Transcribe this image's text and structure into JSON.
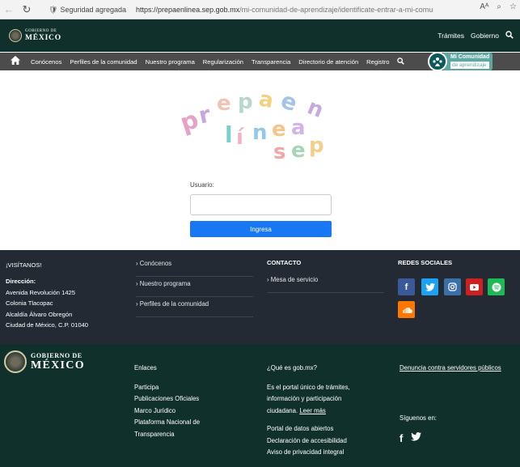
{
  "browser": {
    "security_label": "Seguridad agregada",
    "url_host": "https://prepaenlinea.sep.gob.mx",
    "url_path": "/mi-comunidad-de-aprendizaje/identificate-entrar-a-mi-comunidad/",
    "read_aloud_label": "Aᴬ",
    "zoom_icon": "magnifier-icon",
    "favorites_icon": "star-icon"
  },
  "gov_header": {
    "logo_small": "GOBIERNO DE",
    "logo_big": "MÉXICO",
    "links": [
      "Trámites",
      "Gobierno"
    ]
  },
  "main_nav": {
    "items": [
      "Conócenos",
      "Perfiles de la comunidad",
      "Nuestro programa",
      "Regularización",
      "Transparencia",
      "Directorio de atención",
      "Registro"
    ],
    "badge_line1": "Mi Comunidad",
    "badge_line2": "de aprendizaje"
  },
  "login": {
    "user_label": "Usuario:",
    "user_value": "",
    "submit_label": "Ingresa"
  },
  "footer_top": {
    "visit_title": "¡VISÍTANOS!",
    "address_title": "Dirección:",
    "address_lines": [
      "Avenida Revolución 1425",
      "Colonia Tlacopac",
      "Alcaldía Álvaro Obregón",
      "Ciudad de México, C.P. 01040"
    ],
    "links": [
      "Conócenos",
      "Nuestro programa",
      "Perfiles de la comunidad"
    ],
    "contact_title": "CONTACTO",
    "contact_link": "Mesa de servicio",
    "social_title": "REDES SOCIALES",
    "social": [
      {
        "name": "facebook",
        "glyph": "f",
        "color": "#3b5998"
      },
      {
        "name": "twitter",
        "glyph": "t",
        "color": "#1da1f2"
      },
      {
        "name": "instagram",
        "glyph": "◎",
        "color": "#3a6fa8"
      },
      {
        "name": "youtube",
        "glyph": "▶",
        "color": "#cd201f"
      },
      {
        "name": "spotify",
        "glyph": "≡",
        "color": "#1db954"
      },
      {
        "name": "soundcloud",
        "glyph": "☁",
        "color": "#ff7700"
      }
    ]
  },
  "footer_bottom": {
    "logo_small": "GOBIERNO DE",
    "logo_big": "MÉXICO",
    "links_title": "Enlaces",
    "links": [
      "Participa",
      "Publicaciones Oficiales",
      "Marco Jurídico",
      "Plataforma Nacional de",
      "Transparencia"
    ],
    "what_title": "¿Qué es gob.mx?",
    "what_text": [
      "Es el portal único de trámites,",
      "información y participación",
      "ciudadana."
    ],
    "read_more": "Leer más",
    "more_links": [
      "Portal de datos abiertos",
      "Declaración de accesibilidad",
      "Aviso de privacidad integral"
    ],
    "report_link": "Denuncia contra servidores públicos",
    "follow_label": "Síguenos en:"
  }
}
